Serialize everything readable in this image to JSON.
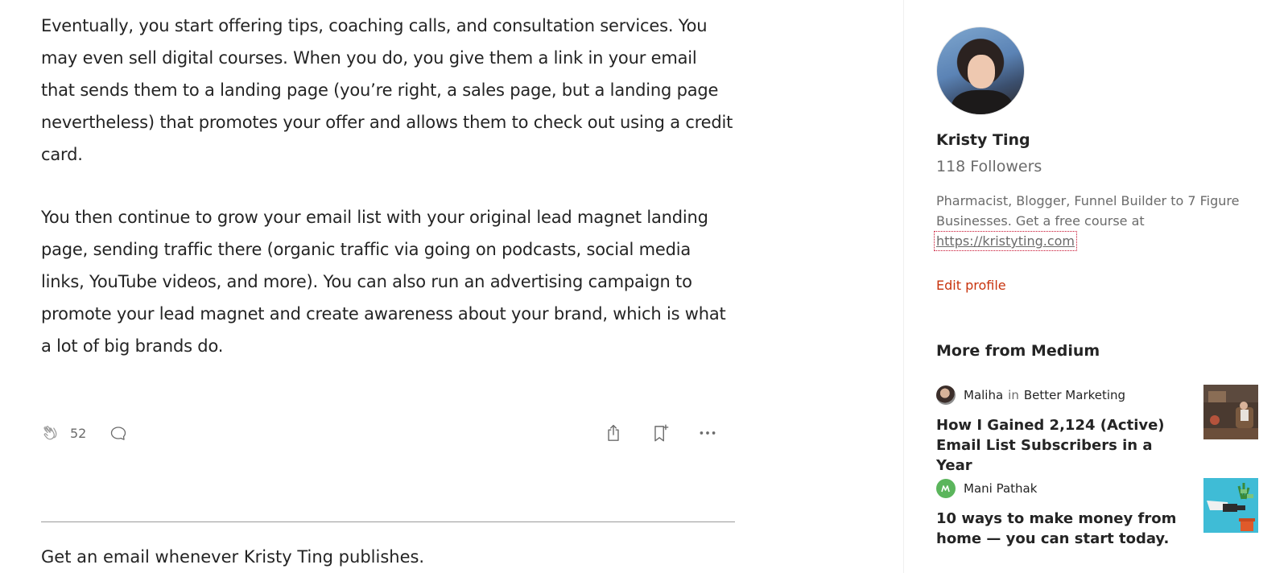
{
  "article": {
    "paragraphs": [
      "Eventually, you start offering tips, coaching calls, and consultation services. You may even sell digital courses. When you do, you give them a link in your email that sends them to a landing page (you’re right, a sales page, but a landing page nevertheless) that promotes your offer and allows them to check out using a credit card.",
      "You then continue to grow your email list with your original lead magnet landing page, sending traffic there (organic traffic via going on podcasts, social media links, YouTube videos, and more). You can also run an advertising campaign to promote your lead magnet and create awareness about your brand, which is what a lot of big brands do."
    ],
    "clap_count": "52",
    "subscribe_title": "Get an email whenever Kristy Ting publishes."
  },
  "icons": {
    "clap": "clap-icon",
    "comment": "comment-icon",
    "share": "share-icon",
    "bookmark": "bookmark-add-icon",
    "more": "more-horizontal-icon"
  },
  "sidebar": {
    "author_name": "Kristy Ting",
    "followers": "118 Followers",
    "bio_text": "Pharmacist, Blogger, Funnel Builder to 7 Figure Businesses. Get a free course at",
    "bio_link": "https://kristyting.com",
    "edit_profile": "Edit profile",
    "more_title": "More from Medium",
    "recommendations": [
      {
        "author": "Maliha",
        "in_label": "in",
        "publication": "Better Marketing",
        "title": "How I Gained 2,124 (Active) Email List Subscribers in a Year"
      },
      {
        "author": "Mani Pathak",
        "title": "10 ways to make money from home — you can start today."
      }
    ]
  },
  "colors": {
    "accent_link": "#c8340e",
    "text_primary": "#242424",
    "text_secondary": "#6b6b6b"
  }
}
